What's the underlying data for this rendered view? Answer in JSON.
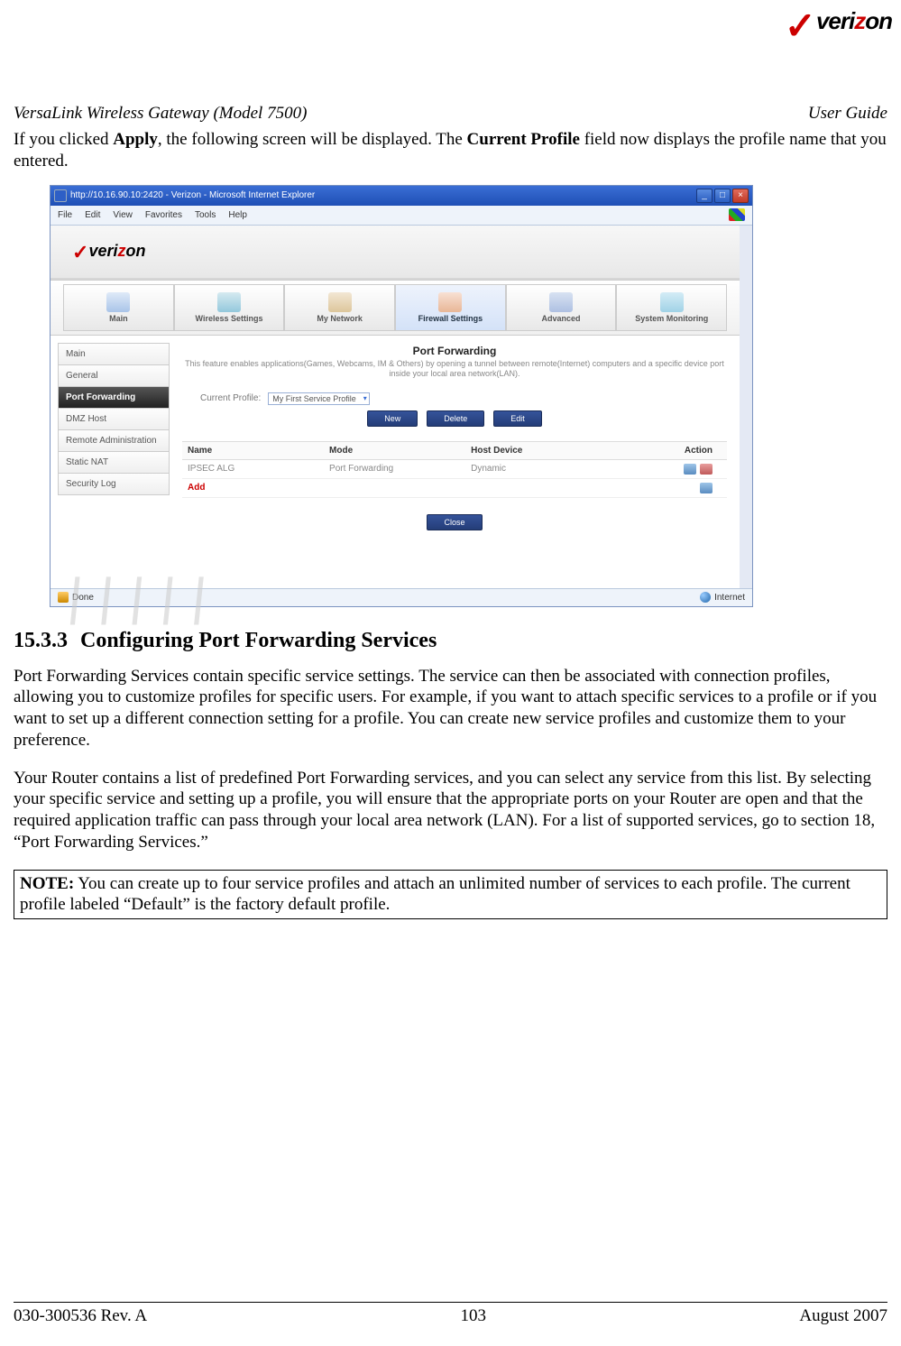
{
  "brand": {
    "name_black": "veri",
    "name_red": "z",
    "name_rest": "on"
  },
  "header": {
    "left": "VersaLink Wireless Gateway (Model 7500)",
    "right": "User Guide"
  },
  "intro": {
    "p1a": "If you clicked ",
    "p1b": "Apply",
    "p1c": ", the following screen will be displayed. The ",
    "p1d": "Current Profile",
    "p1e": " field now displays the profile name that you entered."
  },
  "ie": {
    "title": "http://10.16.90.10:2420 - Verizon - Microsoft Internet Explorer",
    "menus": [
      "File",
      "Edit",
      "View",
      "Favorites",
      "Tools",
      "Help"
    ],
    "status_left": "Done",
    "status_right": "Internet"
  },
  "tabs": [
    {
      "label": "Main"
    },
    {
      "label": "Wireless Settings"
    },
    {
      "label": "My Network"
    },
    {
      "label": "Firewall Settings"
    },
    {
      "label": "Advanced"
    },
    {
      "label": "System Monitoring"
    }
  ],
  "sidebar": [
    {
      "label": "Main"
    },
    {
      "label": "General"
    },
    {
      "label": "Port Forwarding"
    },
    {
      "label": "DMZ Host"
    },
    {
      "label": "Remote Administration"
    },
    {
      "label": "Static NAT"
    },
    {
      "label": "Security Log"
    }
  ],
  "panel": {
    "title": "Port Forwarding",
    "desc": "This feature enables applications(Games, Webcams, IM & Others) by opening a tunnel between remote(Internet) computers and a specific device port inside your local area network(LAN).",
    "profile_label": "Current Profile:",
    "profile_value": "My First Service Profile",
    "buttons": {
      "new": "New",
      "delete": "Delete",
      "edit": "Edit",
      "close": "Close"
    },
    "cols": {
      "name": "Name",
      "mode": "Mode",
      "host": "Host Device",
      "action": "Action"
    },
    "rows": [
      {
        "name": "IPSEC ALG",
        "mode": "Port Forwarding",
        "host": "Dynamic"
      }
    ],
    "add_label": "Add"
  },
  "section": {
    "num": "15.3.3",
    "title": "Configuring Port Forwarding Services",
    "p1": "Port Forwarding Services contain specific service settings. The service can then be associated with connection profiles, allowing you to customize profiles for specific users. For example, if you want to attach specific services to a profile or if you want to set up a different connection setting for a profile. You can create new service profiles and customize them to your preference.",
    "p2": "Your Router contains a list of predefined Port Forwarding services, and you can select any service from this list. By selecting your specific service and setting up a profile, you will ensure that the appropriate ports on your Router are open and that the required application traffic can pass through your local area network (LAN). For a list of supported services, go to section 18, “Port Forwarding Services.”"
  },
  "note": {
    "label": "NOTE:",
    "text": " You can create up to four service profiles and attach an unlimited number of services to each profile. The current profile labeled “Default” is the factory default profile."
  },
  "footer": {
    "left": "030-300536 Rev. A",
    "center": "103",
    "right": "August 2007"
  }
}
